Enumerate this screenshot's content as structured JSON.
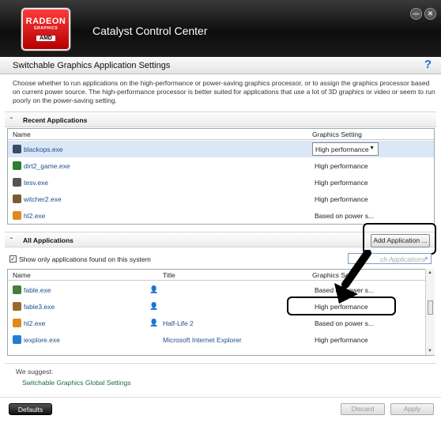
{
  "window": {
    "logo": {
      "line1": "RADEON",
      "line2": "GRAPHICS",
      "brand": "AMD"
    },
    "title": "Catalyst Control Center",
    "minimize_glyph": "—",
    "close_glyph": "✕"
  },
  "page": {
    "title": "Switchable Graphics Application Settings",
    "help_glyph": "?",
    "description": "Choose whether to run applications on the high-performance or power-saving graphics processor, or to assign the graphics processor based on current power source. The high-performance processor is better suited for applications that use a lot of 3D graphics or video or seem to run poorly on the power-saving setting."
  },
  "recent": {
    "section_label": "Recent Applications",
    "col_name": "Name",
    "col_setting": "Graphics Setting",
    "rows": [
      {
        "name": "blackops.exe",
        "setting": "High performance",
        "icon": "blackops-icon",
        "color": "#3b4a66"
      },
      {
        "name": "dirt2_game.exe",
        "setting": "High performance",
        "icon": "dirt2-icon",
        "color": "#2e7d32"
      },
      {
        "name": "tesv.exe",
        "setting": "High performance",
        "icon": "skyrim-icon",
        "color": "#555555"
      },
      {
        "name": "witcher2.exe",
        "setting": "High performance",
        "icon": "witcher-icon",
        "color": "#7a5c2e"
      },
      {
        "name": "hl2.exe",
        "setting": "Based on power s...",
        "icon": "half-life-icon",
        "color": "#e08a1e"
      }
    ]
  },
  "all": {
    "section_label": "All Applications",
    "add_button": "Add Application ...",
    "checkbox_label": "Show only applications found on this system",
    "checkbox_mark": "✓",
    "search_placeholder": "ch Applications",
    "search_glyph": "⌕",
    "col_name": "Name",
    "col_title": "Title",
    "col_setting": "Graphics Se",
    "user_glyph": "👤",
    "rows": [
      {
        "name": "fable.exe",
        "title": "",
        "setting": "Based on power s...",
        "icon": "fable-icon",
        "color": "#4a7c3a"
      },
      {
        "name": "fable3.exe",
        "title": "",
        "setting": "High performance",
        "icon": "fable3-icon",
        "color": "#9a6a2a"
      },
      {
        "name": "hl2.exe",
        "title": "Half-Life 2",
        "setting": "Based on power s...",
        "icon": "half-life-icon",
        "color": "#e08a1e"
      },
      {
        "name": "iexplore.exe",
        "title": "Microsoft Internet Explorer",
        "setting": "High performance",
        "icon": "ie-icon",
        "color": "#1e7fd0"
      }
    ]
  },
  "suggest": {
    "label": "We suggest:",
    "link": "Switchable Graphics Global Settings"
  },
  "footer": {
    "defaults": "Defaults",
    "discard": "Discard",
    "apply": "Apply"
  }
}
